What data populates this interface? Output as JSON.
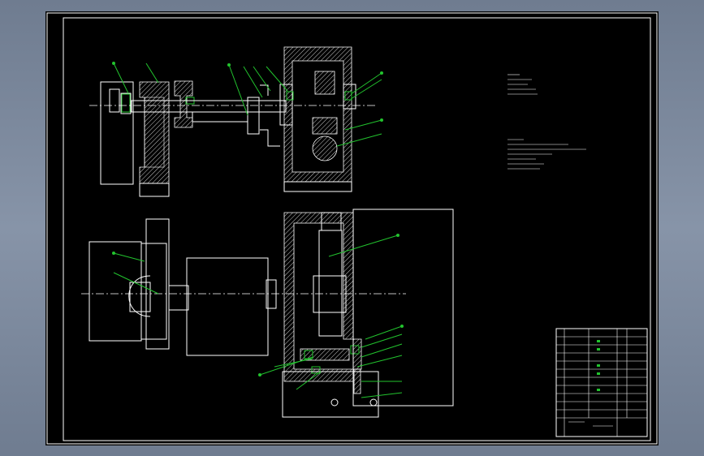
{
  "drawing": {
    "background": "#000000",
    "line_color": "#ffffff",
    "highlight_color": "#22c32e",
    "frame_color": "#6f7c90"
  }
}
